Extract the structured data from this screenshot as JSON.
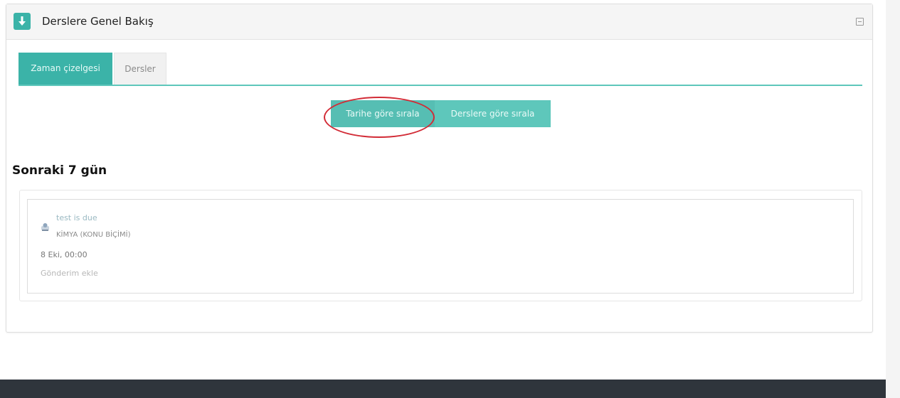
{
  "block": {
    "title": "Derslere Genel Bakış",
    "icon": "download-icon",
    "collapse_icon": "collapse-icon"
  },
  "tabs": [
    {
      "label": "Zaman çizelgesi",
      "active": true
    },
    {
      "label": "Dersler",
      "active": false
    }
  ],
  "sort_buttons": {
    "by_date": "Tarihe göre sırala",
    "by_course": "Derslere göre sırala"
  },
  "section": {
    "heading": "Sonraki 7 gün"
  },
  "event": {
    "icon": "assignment-icon",
    "title": "test is due",
    "course": "KİMYA (KONU BİÇİMİ)",
    "date": "8 Eki, 00:00",
    "action": "Gönderim ekle"
  },
  "colors": {
    "accent": "#3bb3a8",
    "accent_light": "#5ec7bb",
    "annotation": "#d22b36",
    "footer": "#2f353c"
  }
}
